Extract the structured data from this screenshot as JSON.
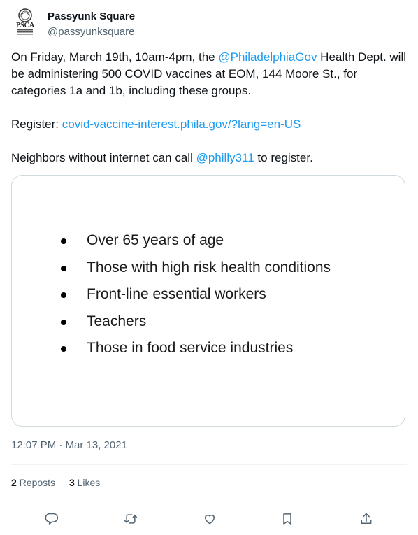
{
  "account": {
    "display_name": "Passyunk Square",
    "handle": "@passyunksquare",
    "avatar_text": "PSCA"
  },
  "tweet": {
    "p1_a": "On Friday, March 19th, 10am-4pm, the ",
    "p1_mention": "@PhiladelphiaGov",
    "p1_b": " Health Dept. will be administering 500 COVID vaccines at EOM, 144 Moore St., for categories 1a and 1b, including these groups.",
    "p2_a": "Register: ",
    "p2_link": "covid-vaccine-interest.phila.gov/?lang=en-US",
    "p3_a": "Neighbors without internet can call ",
    "p3_mention": "@philly311",
    "p3_b": " to register."
  },
  "media": {
    "bullets": [
      "Over 65 years of age",
      "Those with high risk health conditions",
      "Front-line essential workers",
      "Teachers",
      "Those in food service industries"
    ]
  },
  "meta": {
    "timestamp": "12:07 PM · Mar 13, 2021",
    "reposts_count": "2",
    "reposts_label": " Reposts",
    "likes_count": "3",
    "likes_label": " Likes"
  },
  "actions": [
    "reply-icon",
    "repost-icon",
    "like-icon",
    "bookmark-icon",
    "share-icon"
  ],
  "colors": {
    "link": "#1d9bf0",
    "text": "#0f1419",
    "secondary": "#536471",
    "border": "#cfd9de",
    "divider": "#eff3f4"
  }
}
